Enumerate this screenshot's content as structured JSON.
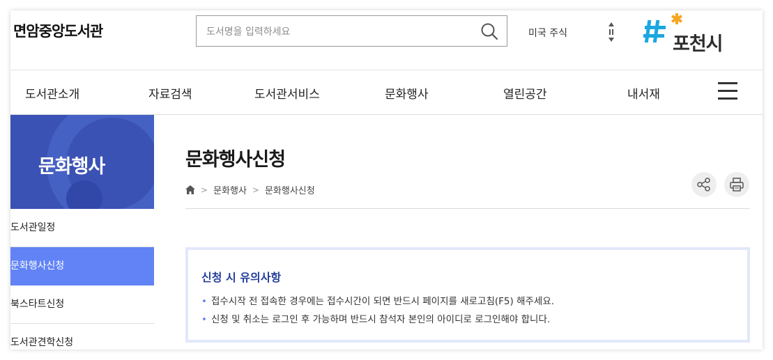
{
  "header": {
    "site_name": "면암중앙도서관",
    "search_placeholder": "도서명을 입력하세요",
    "search_value": "",
    "stock_text": "미국 주식",
    "city_name": "포천시"
  },
  "nav": {
    "items": [
      "도서관소개",
      "자료검색",
      "도서관서비스",
      "문화행사",
      "열린공간",
      "내서재"
    ]
  },
  "sidebar": {
    "title": "문화행사",
    "items": [
      {
        "label": "도서관일정",
        "active": false
      },
      {
        "label": "문화행사신청",
        "active": true
      },
      {
        "label": "북스타트신청",
        "active": false
      },
      {
        "label": "도서관견학신청",
        "active": false
      }
    ]
  },
  "main": {
    "title": "문화행사신청",
    "breadcrumb": [
      "문화행사",
      "문화행사신청"
    ]
  },
  "notice": {
    "title": "신청 시 유의사항",
    "lines": [
      "접수시작 전 접속한 경우에는 접수시간이 되면 반드시 페이지를 새로고침(F5) 해주세요.",
      "신청 및 취소는 로그인 후 가능하며 반드시 참석자 본인의 아이디로 로그인해야 합니다."
    ]
  },
  "colors": {
    "accent": "#6183f6",
    "banner": "#3a52b4",
    "notice_title": "#263f9a",
    "logo_blue": "#1aa7e0",
    "logo_orange": "#f5a623"
  },
  "icons": [
    "search-icon",
    "updown-arrows-icon",
    "hamburger-icon",
    "home-icon",
    "share-icon",
    "print-icon"
  ]
}
